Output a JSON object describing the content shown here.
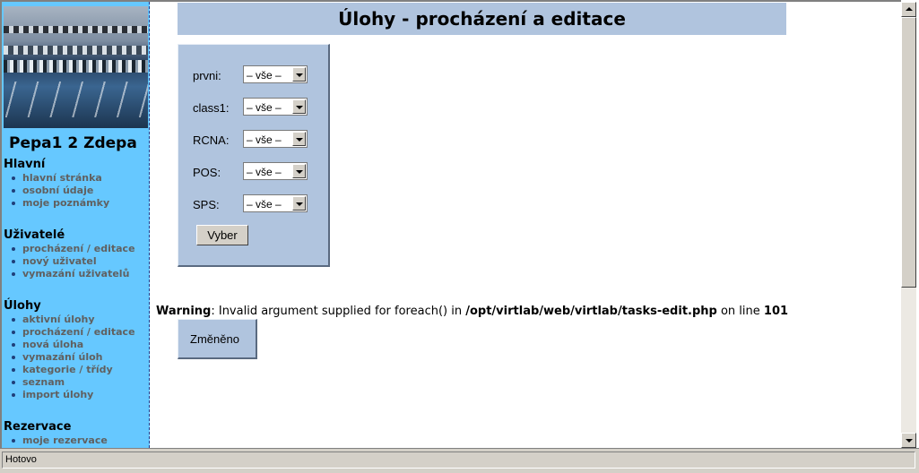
{
  "sidebar": {
    "user_name": "Pepa1 2 Zdepa",
    "sections": [
      {
        "title": "Hlavní",
        "items": [
          "hlavní stránka",
          "osobní údaje",
          "moje poznámky"
        ]
      },
      {
        "title": "Uživatelé",
        "items": [
          "procházení / editace",
          "nový uživatel",
          "vymazání uživatelů"
        ]
      },
      {
        "title": "Úlohy",
        "items": [
          "aktivní úlohy",
          "procházení / editace",
          "nová úloha",
          "vymazání úloh",
          "kategorie / třídy",
          "seznam",
          "import úlohy"
        ]
      },
      {
        "title": "Rezervace",
        "items": [
          "moje rezervace"
        ]
      }
    ]
  },
  "main": {
    "title": "Úlohy - procházení a editace",
    "filters": [
      {
        "label": "prvni:",
        "value": "– vše –"
      },
      {
        "label": "class1:",
        "value": "– vše –"
      },
      {
        "label": "RCNA:",
        "value": "– vše –"
      },
      {
        "label": "POS:",
        "value": "– vše –"
      },
      {
        "label": "SPS:",
        "value": "– vše –"
      }
    ],
    "submit_label": "Vyber",
    "warning": {
      "label": "Warning",
      "message": ": Invalid argument supplied for foreach() in ",
      "path": "/opt/virtlab/web/virtlab/tasks-edit.php",
      "line_text": " on line ",
      "line": "101"
    },
    "changed_label": "Změněno"
  },
  "statusbar": {
    "text": "Hotovo"
  }
}
